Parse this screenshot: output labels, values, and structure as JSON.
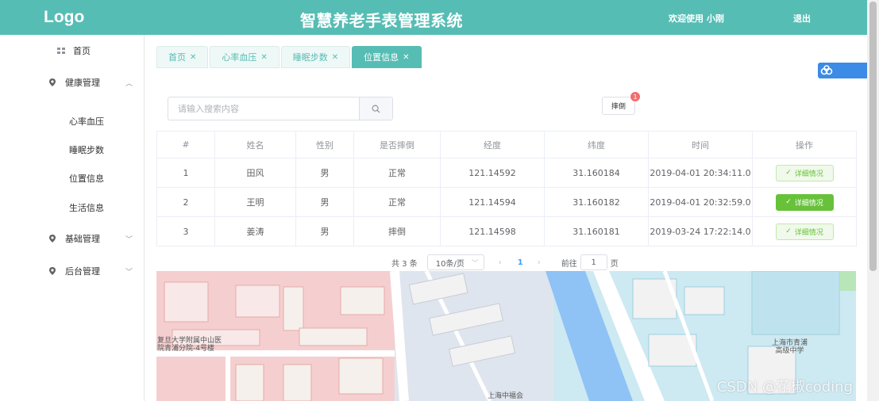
{
  "header": {
    "logo": "Logo",
    "title": "智慧养老手表管理系统",
    "welcome": "欢迎使用 小刚",
    "logout": "退出",
    "bg_color": "#56bdb4"
  },
  "sidebar": {
    "home": "首页",
    "health": "健康管理",
    "health_sub": [
      "心率血压",
      "睡眠步数",
      "位置信息",
      "生活信息"
    ],
    "basic": "基础管理",
    "backend": "后台管理"
  },
  "tabs": [
    {
      "label": "首页",
      "active": false
    },
    {
      "label": "心率血压",
      "active": false
    },
    {
      "label": "睡眠步数",
      "active": false
    },
    {
      "label": "位置信息",
      "active": true
    }
  ],
  "search": {
    "placeholder": "请输入搜索内容"
  },
  "fall_button": {
    "label": "摔倒",
    "badge": "1"
  },
  "table": {
    "headers": [
      "#",
      "姓名",
      "性别",
      "是否摔倒",
      "经度",
      "纬度",
      "时间",
      "操作"
    ],
    "rows": [
      {
        "no": "1",
        "name": "田风",
        "gender": "男",
        "status": "正常",
        "lng": "121.14592",
        "lat": "31.160184",
        "time": "2019-04-01 20:34:11.0",
        "action": "详细情况"
      },
      {
        "no": "2",
        "name": "王明",
        "gender": "男",
        "status": "正常",
        "lng": "121.14594",
        "lat": "31.160182",
        "time": "2019-04-01 20:32:59.0",
        "action": "详细情况"
      },
      {
        "no": "3",
        "name": "姜涛",
        "gender": "男",
        "status": "摔倒",
        "lng": "121.14598",
        "lat": "31.160181",
        "time": "2019-03-24 17:22:14.0",
        "action": "详细情况"
      }
    ]
  },
  "pagination": {
    "total": "共 3 条",
    "page_size": "10条/页",
    "current_page": "1",
    "goto_label": "前往",
    "goto_value": "1",
    "goto_unit": "页"
  },
  "map": {
    "labels": [
      "复旦大学附属中山医",
      "院青浦分院-4号楼",
      "上海市青浦",
      "高级中学",
      "上海中福会"
    ],
    "watermark": "CSDN @花椒coding"
  }
}
